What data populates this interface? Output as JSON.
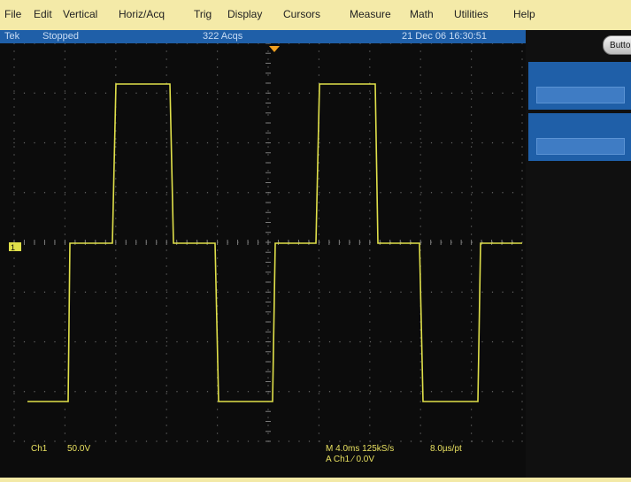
{
  "menu": {
    "items": [
      "File",
      "Edit",
      "Vertical",
      "Horiz/Acq",
      "Trig",
      "Display",
      "Cursors",
      "Measure",
      "Math",
      "Utilities",
      "Help"
    ]
  },
  "status": {
    "brand": "Tek",
    "run_state": "Stopped",
    "acqs": "322 Acqs",
    "datetime": "21 Dec 06 16:30:51"
  },
  "side": {
    "buttons_label": "Buttons"
  },
  "scope": {
    "channel_marker": "1",
    "ch_label": "Ch1",
    "ch_scale": "50.0V",
    "timebase": "M 4.0ms 125kS/s",
    "resolution": "8.0µs/pt",
    "trigger": "A  Ch1  ∕  0.0V"
  },
  "colors": {
    "menu_bg": "#f4eaa8",
    "status_bg": "#1f5fa8",
    "screen_bg": "#0c0c0c",
    "trace": "#e0e04a",
    "trigger_marker": "#f0a020"
  }
}
